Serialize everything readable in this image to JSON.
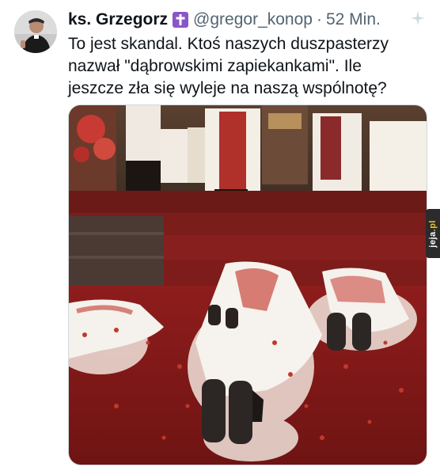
{
  "author": {
    "name": "ks. Grzegorz",
    "handle": "@gregor_konop",
    "separator": "·",
    "time": "52 Min.",
    "badge_icon": "purple-cross-icon",
    "badge_color": "#8a55c9"
  },
  "tweet": {
    "lines": [
      "To jest skandal. Ktoś naszych duszpasterzy",
      "nazwał \"dąbrowskimi zapiekankami\". Ile",
      "jeszcze zła się wyleje na naszą wspólnotę?"
    ]
  },
  "watermark": {
    "prefix": "jeja",
    "suffix": ".pl"
  },
  "colors": {
    "text_primary": "#0f1419",
    "text_secondary": "#536471",
    "carpet_red": "#8e1d1c"
  }
}
